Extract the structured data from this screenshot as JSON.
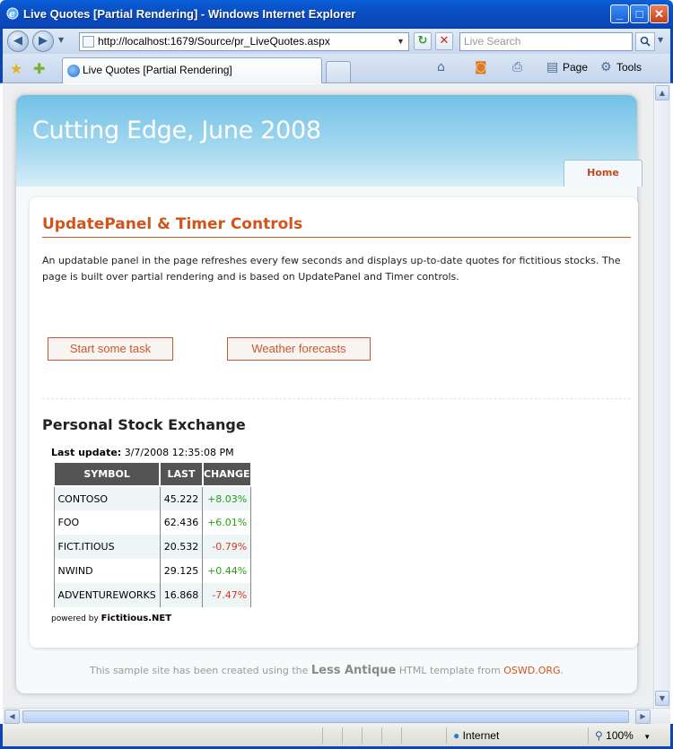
{
  "window": {
    "title": "Live Quotes [Partial Rendering] - Windows Internet Explorer",
    "minimize": "_",
    "maximize": "□",
    "close": "✕"
  },
  "browser": {
    "url": "http://localhost:1679/Source/pr_LiveQuotes.aspx",
    "search_placeholder": "Live Search",
    "tab_label": "Live Quotes [Partial Rendering]",
    "page_menu": "Page",
    "tools_menu": "Tools",
    "status_zone": "Internet",
    "zoom_level": "100%"
  },
  "site": {
    "title": "Cutting Edge, June 2008",
    "nav_home": "Home"
  },
  "main": {
    "heading": "UpdatePanel & Timer Controls",
    "intro": "An updatable panel in the page refreshes every few seconds and displays up-to-date quotes for fictitious stocks. The page is built over partial rendering and is based on UpdatePanel and Timer controls.",
    "button_task": "Start some task",
    "button_weather": "Weather forecasts",
    "stock_title": "Personal Stock Exchange",
    "last_update_label": "Last update:",
    "last_update_value": "3/7/2008 12:35:08 PM",
    "columns": [
      "SYMBOL",
      "LAST",
      "CHANGE"
    ],
    "rows": [
      {
        "symbol": "CONTOSO",
        "last": "45.222",
        "change": "+8.03%",
        "direction": "up"
      },
      {
        "symbol": "FOO",
        "last": "62.436",
        "change": "+6.01%",
        "direction": "up"
      },
      {
        "symbol": "FICT.ITIOUS",
        "last": "20.532",
        "change": "-0.79%",
        "direction": "down"
      },
      {
        "symbol": "NWIND",
        "last": "29.125",
        "change": "+0.44%",
        "direction": "up"
      },
      {
        "symbol": "ADVENTUREWORKS",
        "last": "16.868",
        "change": "-7.47%",
        "direction": "down"
      }
    ],
    "powered_by_label": "powered by",
    "powered_by_name": "Fictitious.NET"
  },
  "footer": {
    "text_before": "This sample site has been created using the",
    "brand": "Less Antique",
    "text_mid": "HTML template from",
    "link": "OSWD.ORG",
    "text_end": "."
  },
  "colors": {
    "accent": "#d2541a",
    "header_blue": "#72c1e6",
    "positive": "#2c9a1a",
    "negative": "#d83a1a",
    "table_header": "#545454"
  }
}
